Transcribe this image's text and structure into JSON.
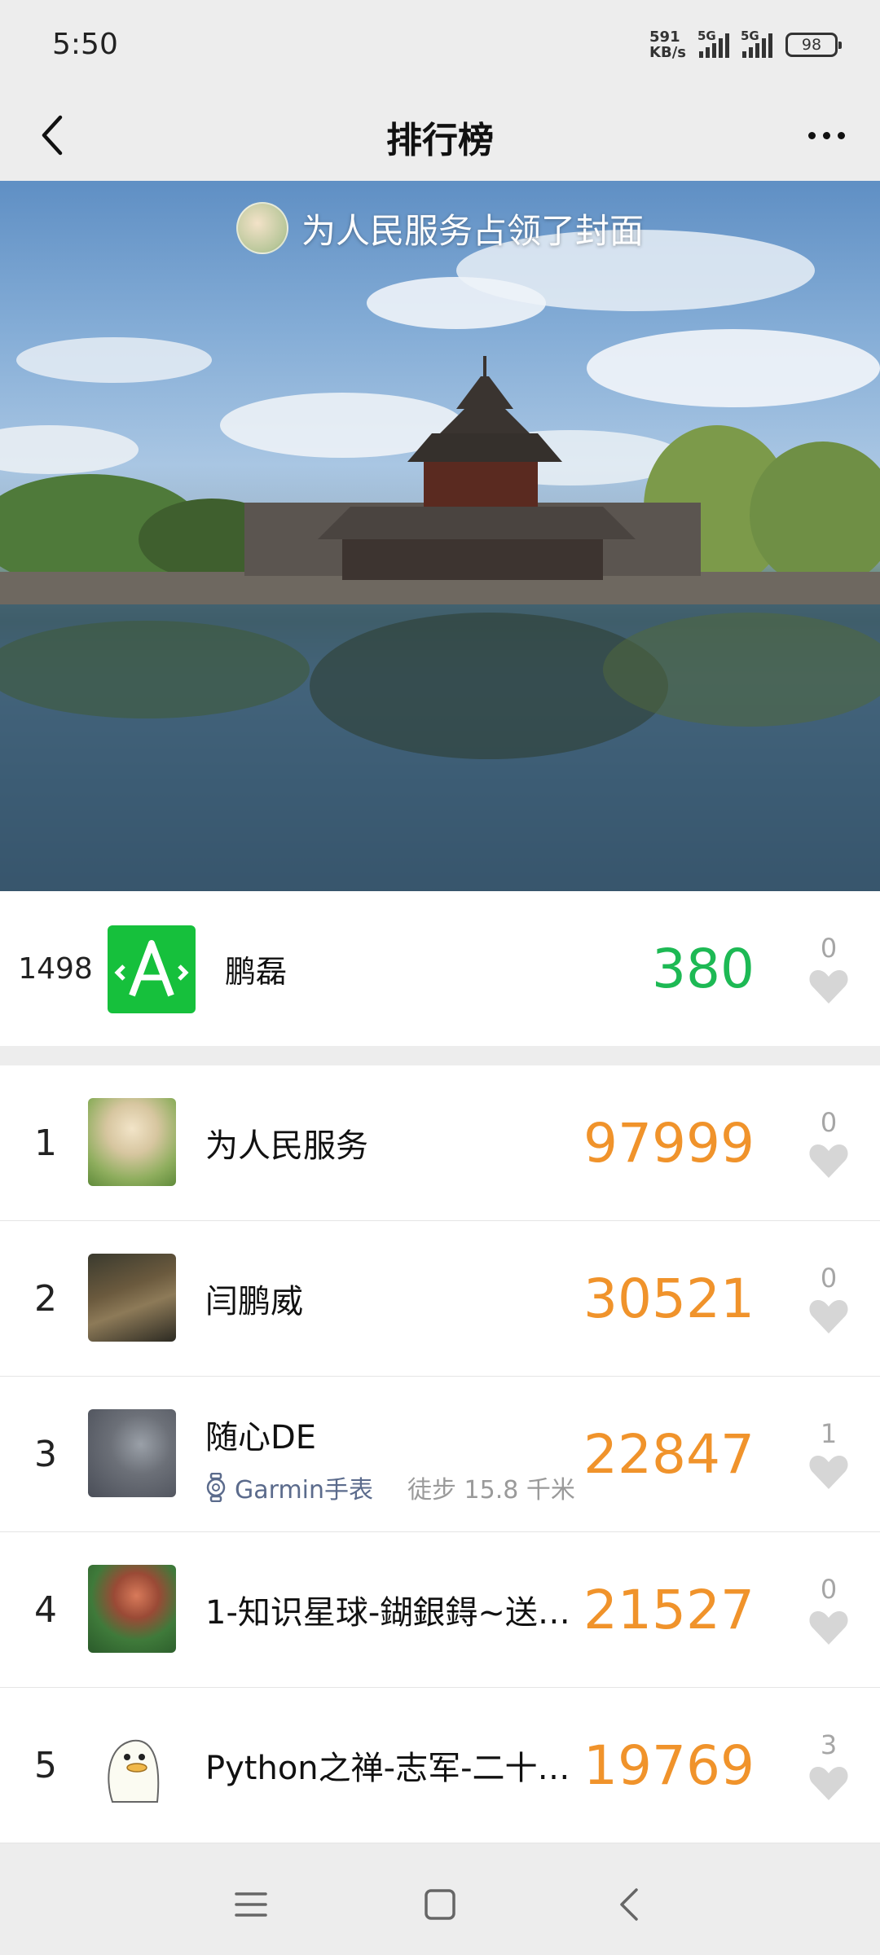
{
  "status_bar": {
    "time": "5:50",
    "net_speed_value": "591",
    "net_speed_unit": "KB/s",
    "sim1": "5G",
    "sim2": "5G",
    "battery": "98"
  },
  "nav": {
    "title": "排行榜",
    "back_icon": "chevron-left-icon",
    "more_icon": "more-dots-icon"
  },
  "cover": {
    "caption": "为人民服务占领了封面"
  },
  "my_entry": {
    "rank": "1498",
    "avatar_letter": "A",
    "name": "鹏磊",
    "steps": "380",
    "likes": "0"
  },
  "ranking": [
    {
      "rank": "1",
      "name": "为人民服务",
      "steps": "97999",
      "likes": "0"
    },
    {
      "rank": "2",
      "name": "闫鹏威",
      "steps": "30521",
      "likes": "0"
    },
    {
      "rank": "3",
      "name": "随心DE",
      "device": "Garmin手表",
      "device_meta": "徒步 15.8 千米",
      "steps": "22847",
      "likes": "1"
    },
    {
      "rank": "4",
      "name": "1-知识星球-鍸銀鍀~送…",
      "steps": "21527",
      "likes": "0"
    },
    {
      "rank": "5",
      "name": "Python之禅-志军-二十…",
      "steps": "19769",
      "likes": "3"
    }
  ],
  "colors": {
    "step_accent": "#f0932b",
    "my_step": "#1db954",
    "background": "#ededed"
  },
  "system_nav": {
    "menu_icon": "menu-icon",
    "home_icon": "home-square-icon",
    "back_icon": "back-triangle-icon"
  }
}
